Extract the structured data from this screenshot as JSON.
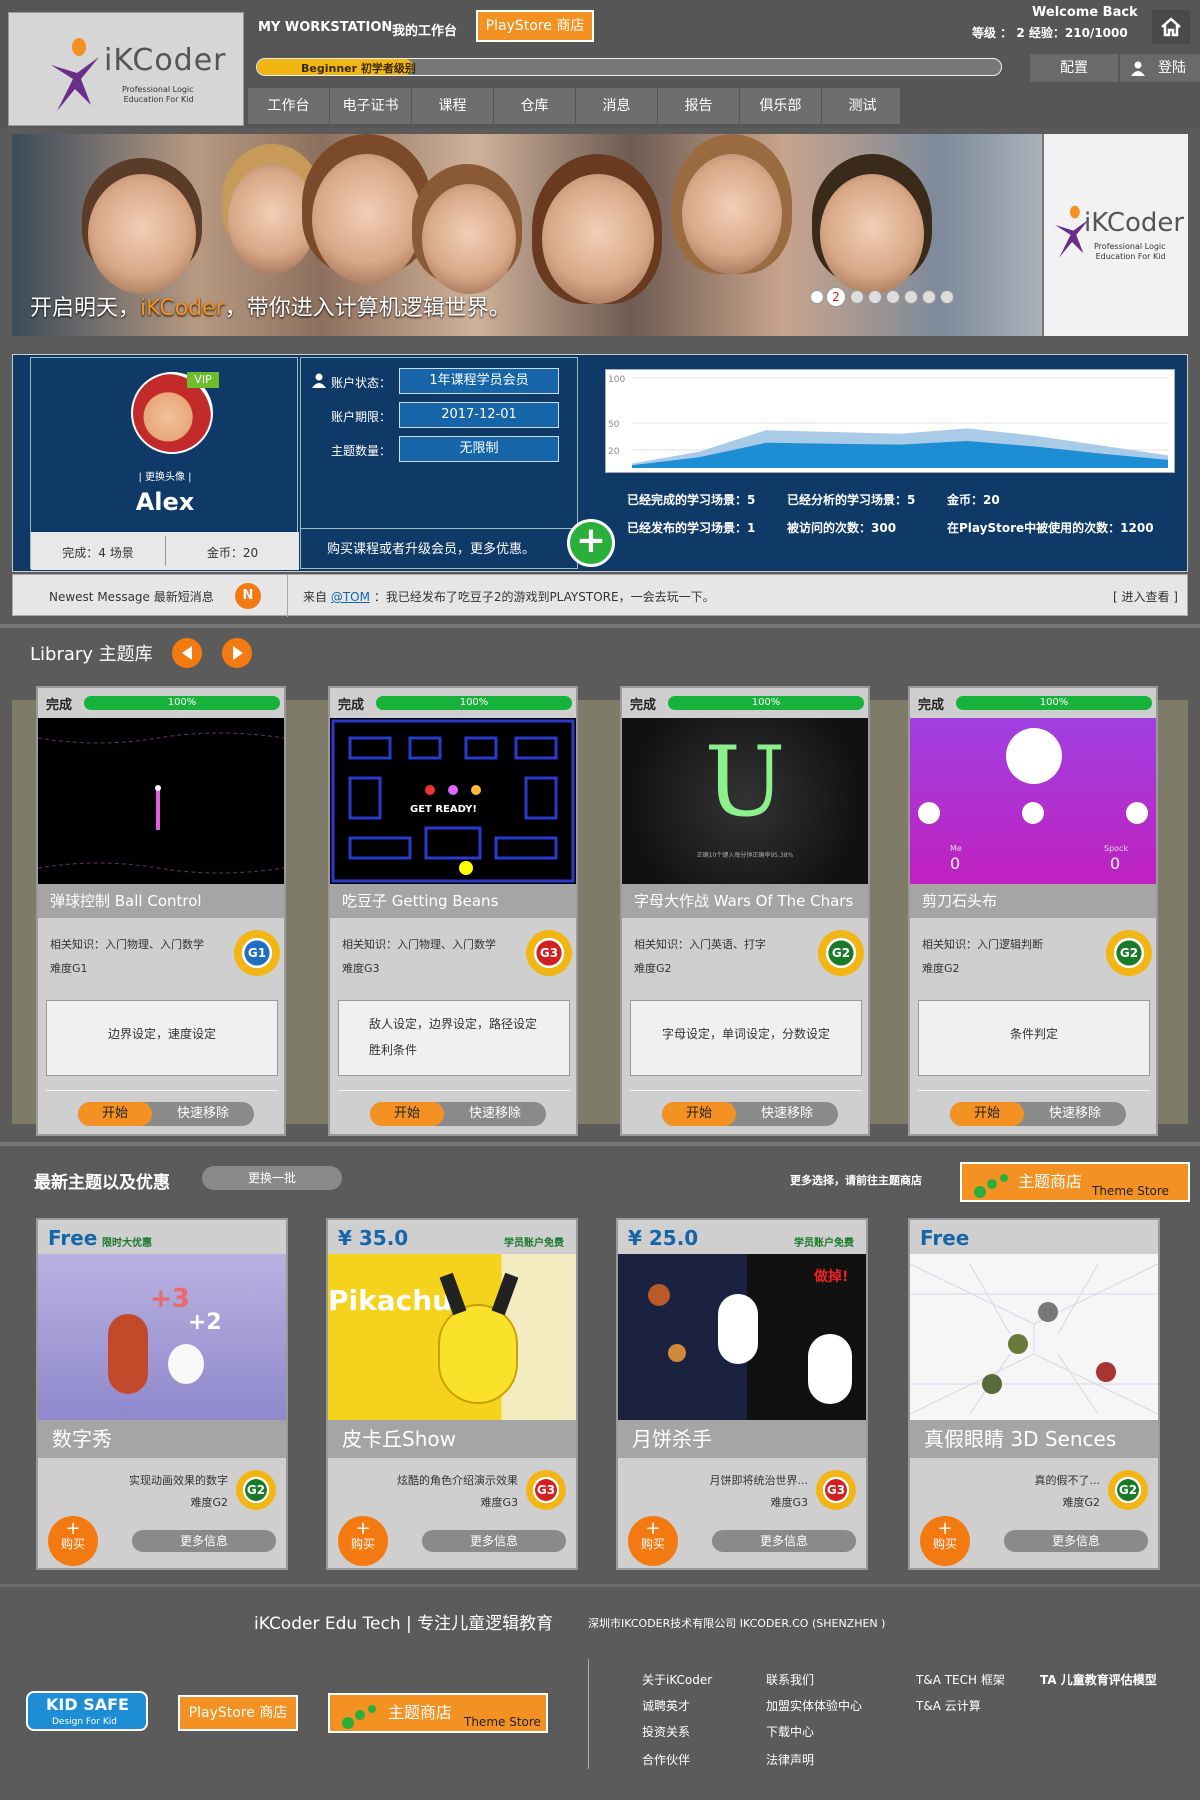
{
  "header": {
    "brand": "iKCoder",
    "brand_sub_1": "Professional Logic",
    "brand_sub_2": "Education For Kid",
    "my_workstation_en": "MY WORKSTATION",
    "my_workstation_cn": "我的工作台",
    "playstore_btn": "PlayStore 商店",
    "welcome": "Welcome Back",
    "level_exp": "等级 ： 2  经验：210/1000",
    "level_badge": "Beginner 初学者级别",
    "progress_fraction": 0.21,
    "config_btn": "配置",
    "login_btn": "登陆",
    "home_icon": "home-icon",
    "user_icon": "user-icon"
  },
  "nav": {
    "tabs": [
      "工作台",
      "电子证书",
      "课程",
      "仓库",
      "消息",
      "报告",
      "俱乐部",
      "测试"
    ]
  },
  "banner": {
    "tagline_prefix": "开启明天，",
    "tagline_brand": "iKCoder",
    "tagline_suffix": "，带你进入计算机逻辑世界。",
    "current_slide": "2",
    "slide_count": 8,
    "brand": "iKCoder",
    "brand_sub_1": "Professional Logic",
    "brand_sub_2": "Education For Kid"
  },
  "profile": {
    "vip": "VIP",
    "change_avatar": "| 更换头像 |",
    "name": "Alex",
    "completed": "完成：4 场景",
    "coins": "金币：20",
    "account_status_label": "账户状态：",
    "account_status": "1年课程学员会员",
    "expiry_label": "账户期限：",
    "expiry": "2017-12-01",
    "themes_label": "主题数量：",
    "themes": "无限制",
    "upgrade_text": "购买课程或者升级会员，更多优惠。",
    "stats": [
      "已经完成的学习场景：5",
      "已经分析的学习场景：5",
      "金币：20",
      "已经发布的学习场景：1",
      "被访问的次数：300",
      "在PlayStore中被使用的次数：1200"
    ]
  },
  "chart_data": {
    "type": "area",
    "title": "",
    "xlabel": "",
    "ylabel": "",
    "y_ticks": [
      "100",
      "50",
      "20"
    ],
    "ylim": [
      0,
      100
    ],
    "grid": true,
    "series": [
      {
        "values": [
          5,
          18,
          42,
          40,
          38,
          44,
          36,
          25,
          14
        ]
      },
      {
        "values": [
          3,
          12,
          28,
          27,
          26,
          30,
          24,
          16,
          9
        ]
      }
    ],
    "colors": [
      "#a9cbe8",
      "#1e8ed4"
    ]
  },
  "message": {
    "label": "Newest Message 最新短消息",
    "badge": "N",
    "from": "来自",
    "user": "@TOM",
    "text": "：我已经发布了吃豆子2的游戏到PLAYSTORE，一会去玩一下。",
    "view": "[ 进入查看 ]"
  },
  "library": {
    "title": "Library 主题库",
    "games": [
      {
        "done": "完成",
        "pct": "100%",
        "title": "弹球控制  Ball Control",
        "knowledge": "相关知识：入门物理、入门数学",
        "difficulty": "难度G1",
        "grade": "G1",
        "desc": "边界设定，速度设定",
        "start": "开始",
        "remove": "快速移除"
      },
      {
        "done": "完成",
        "pct": "100%",
        "title": "吃豆子  Getting Beans",
        "knowledge": "相关知识：入门物理、入门数学",
        "difficulty": "难度G3",
        "grade": "G3",
        "desc": "敌人设定，边界设定，路径设定 胜利条件",
        "start": "开始",
        "remove": "快速移除",
        "thumb_text": "GET READY!"
      },
      {
        "done": "完成",
        "pct": "100%",
        "title": "字母大作战 Wars Of The Chars",
        "knowledge": "相关知识：入门英语、打字",
        "difficulty": "难度G2",
        "grade": "G2",
        "desc": "字母设定，单词设定，分数设定",
        "start": "开始",
        "remove": "快速移除",
        "thumb_text": "U",
        "thumb_caption": "正确10个键入每分钟正确率95.38%"
      },
      {
        "done": "完成",
        "pct": "100%",
        "title": "剪刀石头布",
        "knowledge": "相关知识：入门逻辑判断",
        "difficulty": "难度G2",
        "grade": "G2",
        "desc": "条件判定",
        "start": "开始",
        "remove": "快速移除",
        "me_label": "Me",
        "me_score": "0",
        "spock_label": "Spock",
        "spock_score": "0"
      }
    ]
  },
  "store": {
    "title": "最新主题以及优惠",
    "refresh": "更换一批",
    "more_hint": "更多选择，请前往主题商店",
    "store_btn_cn": "主题商店",
    "store_btn_en": "Theme Store",
    "themes": [
      {
        "price": "Free",
        "promo": "限时大优惠",
        "title": "数字秀",
        "desc": "实现动画效果的数字",
        "difficulty": "难度G2",
        "grade": "G2",
        "buy": "购买",
        "more": "更多信息",
        "art1": "+3",
        "art2": "+2"
      },
      {
        "price": "¥ 35.0",
        "promo": "学员账户免费",
        "title": "皮卡丘Show",
        "desc": "炫酷的角色介绍演示效果",
        "difficulty": "难度G3",
        "grade": "G3",
        "buy": "购买",
        "more": "更多信息",
        "art1": "Pikachu"
      },
      {
        "price": "¥ 25.0",
        "promo": "学员账户免费",
        "title": "月饼杀手",
        "desc": "月饼即将统治世界...",
        "difficulty": "难度G3",
        "grade": "G3",
        "buy": "购买",
        "more": "更多信息",
        "art1": "做掉!"
      },
      {
        "price": "Free",
        "promo": "",
        "title": "真假眼睛 3D Sences",
        "desc": "真的假不了...",
        "difficulty": "难度G2",
        "grade": "G2",
        "buy": "购买",
        "more": "更多信息"
      }
    ]
  },
  "footer": {
    "title": "iKCoder Edu Tech | 专注儿童逻辑教育",
    "company": "深圳市IKCODER技术有限公司 IKCODER.CO (SHENZHEN )",
    "kid_safe": "KID SAFE",
    "kid_safe_sub": "Design For Kid",
    "playstore": "PlayStore 商店",
    "store_cn": "主题商店",
    "store_en": "Theme Store",
    "links_col1": [
      "关于iKCoder",
      "诚聘英才",
      "投资关系",
      "合作伙伴"
    ],
    "links_col2": [
      "联系我们",
      "加盟实体体验中心",
      "下载中心",
      "法律声明"
    ],
    "links_col3": [
      "T&A TECH 框架",
      "T&A 云计算"
    ],
    "links_col4": [
      "TA 儿童教育评估模型"
    ]
  }
}
